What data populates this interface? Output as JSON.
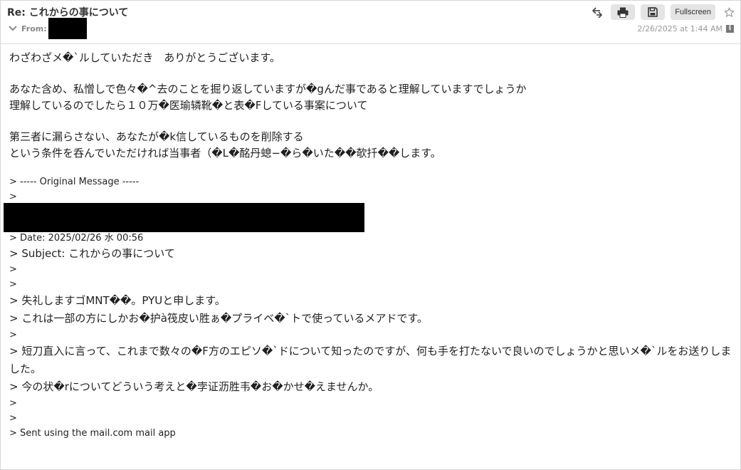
{
  "header": {
    "subject": "Re: これからの事について",
    "from_label": "From:",
    "date": "2/26/2025 at 1:44 AM",
    "fullscreen_label": "Fullscreen",
    "info_icon": "i"
  },
  "icons": {
    "reply": "reply-arrows-icon",
    "print": "print-icon",
    "save": "save-icon",
    "star": "star-icon",
    "chevron": "chevron-down-icon",
    "info": "info-icon"
  },
  "colors": {
    "button_bg": "#e4e4e4",
    "meta_text": "#999999",
    "redaction": "#000000"
  },
  "message": {
    "greeting": "わざわざメ�`ルしていただき　ありがとうございます。",
    "para1_line1": "あなた含め、私憎しで色々�^去のことを掘り返していますが�gんだ事であると理解していますでしょうか",
    "para1_line2": "理解しているのでしたら１０万�医瑜辚靴�と表�Fしている事案について",
    "para2_line1": "第三者に漏らさない、あなたが�k信しているものを削除する",
    "para2_line2": "という条件を呑んでいただければ当事者（�L�酩丹螅−�ら�いた��欹扦��します。"
  },
  "quoted": {
    "original_header": "> ----- Original Message -----",
    "blank": ">",
    "date_line": "> Date: 2025/02/26 水 00:56",
    "subject_line": "> Subject: これからの事について",
    "body1": "> 失礼しますゴMNT��。PYUと申します。",
    "body2": "> これは一部の方にしかお�护à筏皮い胜ぁ�プライベ�`トで使っているメアドです。",
    "body3": "> 短刀直入に言って、これまで数々の�F方のエピソ�`ドについて知ったのですが、何も手を打たないで良いのでしょうかと思いメ�`ルをお送りしました。",
    "body4": "> 今の状�rについてどういう考えと�孛证沥胜韦�お�かせ�えませんか。",
    "signature": "> Sent using the mail.com mail app"
  }
}
